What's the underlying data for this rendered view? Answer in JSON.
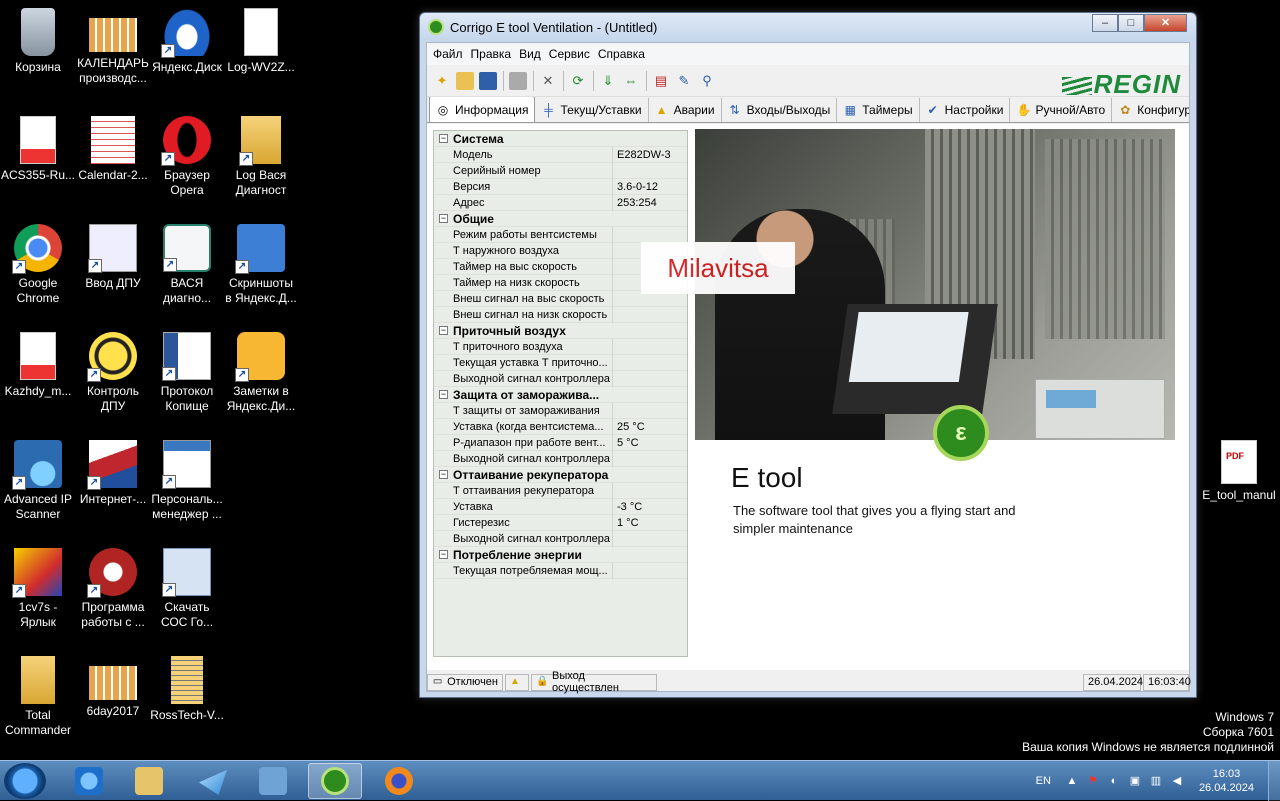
{
  "desktop_icons": [
    {
      "id": "recycle",
      "label": "Корзина",
      "icon": "recycle-bin-icon",
      "col": 0,
      "row": 0
    },
    {
      "id": "cal1",
      "label": "КАЛЕНДАРЬ\nпроизводс...",
      "icon": "spreadsheet-icon",
      "col": 1,
      "row": 0
    },
    {
      "id": "ydisk",
      "label": "Яндекс.Диск",
      "icon": "yandex-disk-icon",
      "col": 2,
      "row": 0
    },
    {
      "id": "log",
      "label": "Log-WV2Z...",
      "icon": "text-file-icon",
      "col": 3,
      "row": 0
    },
    {
      "id": "acs",
      "label": "ACS355-Ru...",
      "icon": "pdf-icon",
      "col": 0,
      "row": 1
    },
    {
      "id": "cal2",
      "label": "Calendar-2...",
      "icon": "calendar-icon",
      "col": 1,
      "row": 1
    },
    {
      "id": "opera",
      "label": "Браузер\nOpera",
      "icon": "opera-icon",
      "col": 2,
      "row": 1
    },
    {
      "id": "logvasya",
      "label": "Log Вася\nДиагност",
      "icon": "folder-icon",
      "col": 3,
      "row": 1
    },
    {
      "id": "chrome",
      "label": "Google\nChrome",
      "icon": "chrome-icon",
      "col": 0,
      "row": 2
    },
    {
      "id": "dpu",
      "label": "Ввод ДПУ",
      "icon": "documents-icon",
      "col": 1,
      "row": 2
    },
    {
      "id": "vasya",
      "label": "ВАСЯ\nдиагно...",
      "icon": "vasya-diag-icon",
      "col": 2,
      "row": 2
    },
    {
      "id": "screens",
      "label": "Скриншоты\nв Яндекс.Д...",
      "icon": "scissors-icon",
      "col": 3,
      "row": 2
    },
    {
      "id": "kazhdy",
      "label": "Kazhdy_m...",
      "icon": "pdf-icon",
      "col": 0,
      "row": 3
    },
    {
      "id": "kdpu",
      "label": "Контроль\nДПУ",
      "icon": "bee-icon",
      "col": 1,
      "row": 3
    },
    {
      "id": "protokol",
      "label": "Протокол\nКопище",
      "icon": "word-doc-icon",
      "col": 2,
      "row": 3
    },
    {
      "id": "notes",
      "label": "Заметки в\nЯндекс.Ди...",
      "icon": "notes-icon",
      "col": 3,
      "row": 3
    },
    {
      "id": "ipscan",
      "label": "Advanced IP\nScanner",
      "icon": "network-scan-icon",
      "col": 0,
      "row": 4
    },
    {
      "id": "inet",
      "label": "Интернет-...",
      "icon": "internet-icon",
      "col": 1,
      "row": 4
    },
    {
      "id": "persmgr",
      "label": "Персональ...\nменеджер ...",
      "icon": "personal-manager-icon",
      "col": 2,
      "row": 4
    },
    {
      "id": "1c",
      "label": "1cv7s -\nЯрлык",
      "icon": "1c-icon",
      "col": 0,
      "row": 5
    },
    {
      "id": "prog",
      "label": "Программа\nработы с ...",
      "icon": "program-icon",
      "col": 1,
      "row": 5
    },
    {
      "id": "soc",
      "label": "Скачать\nСОС Го...",
      "icon": "download-settings-icon",
      "col": 2,
      "row": 5
    },
    {
      "id": "tc",
      "label": "Total\nCommander",
      "icon": "folder-zip-icon",
      "col": 0,
      "row": 6
    },
    {
      "id": "6day",
      "label": "6day2017",
      "icon": "spreadsheet-icon",
      "col": 1,
      "row": 6
    },
    {
      "id": "ross",
      "label": "RossTech-V...",
      "icon": "zip-folder-icon",
      "col": 2,
      "row": 6
    }
  ],
  "right_icon": {
    "label": "E_tool_manul",
    "icon": "pdf-icon"
  },
  "window": {
    "title": "Corrigo E tool Ventilation - (Untitled)",
    "buttons": {
      "minimize": "–",
      "maximize": "□",
      "close": "✕"
    },
    "menu": [
      "Файл",
      "Правка",
      "Вид",
      "Сервис",
      "Справка"
    ],
    "logo": "REGIN",
    "tabs": [
      {
        "label": "Информация",
        "icon": "info-icon",
        "active": true
      },
      {
        "label": "Текущ/Уставки",
        "icon": "setpoint-icon"
      },
      {
        "label": "Аварии",
        "icon": "alarm-bell-icon"
      },
      {
        "label": "Входы/Выходы",
        "icon": "io-arrows-icon"
      },
      {
        "label": "Таймеры",
        "icon": "timer-icon"
      },
      {
        "label": "Настройки",
        "icon": "settings-icon"
      },
      {
        "label": "Ручной/Авто",
        "icon": "hand-icon"
      },
      {
        "label": "Конфигурац",
        "icon": "config-icon"
      }
    ]
  },
  "tree": [
    {
      "type": "sec",
      "name": "Система"
    },
    {
      "name": "Модель",
      "value": "E282DW-3"
    },
    {
      "name": "Серийный номер",
      "value": ""
    },
    {
      "name": "Версия",
      "value": "3.6-0-12"
    },
    {
      "name": "Адрес",
      "value": "253:254"
    },
    {
      "type": "sec",
      "name": "Общие"
    },
    {
      "name": "Режим работы вентсистемы",
      "value": ""
    },
    {
      "name": "Т наружного воздуха",
      "value": ""
    },
    {
      "name": "Таймер на выс скорость",
      "value": ""
    },
    {
      "name": "Таймер на низк скорость",
      "value": ""
    },
    {
      "name": "Внеш сигнал на выс скорость",
      "value": ""
    },
    {
      "name": "Внеш сигнал на низк скорость",
      "value": ""
    },
    {
      "type": "sec",
      "name": "Приточный воздух"
    },
    {
      "name": "Т приточного воздуха",
      "value": ""
    },
    {
      "name": "Текущая уставка Т приточно...",
      "value": ""
    },
    {
      "name": "Выходной сигнал контроллера",
      "value": ""
    },
    {
      "type": "sec",
      "name": "Защита от заморажива..."
    },
    {
      "name": "Т защиты от замораживания",
      "value": ""
    },
    {
      "name": "Уставка (когда вентсистема...",
      "value": "25 °C"
    },
    {
      "name": "Р-диапазон при работе вент...",
      "value": "5 °C"
    },
    {
      "name": "Выходной сигнал контроллера",
      "value": ""
    },
    {
      "type": "sec",
      "name": "Оттаивание рекуператора"
    },
    {
      "name": "Т оттаивания рекуператора",
      "value": ""
    },
    {
      "name": "Уставка",
      "value": "-3 °C"
    },
    {
      "name": "Гистерезис",
      "value": "1 °C"
    },
    {
      "name": "Выходной сигнал контроллера",
      "value": ""
    },
    {
      "type": "sec",
      "name": "Потребление энергии"
    },
    {
      "name": "Текущая потребляемая мощ...",
      "value": ""
    }
  ],
  "splash": {
    "watermark": "Milavitsa",
    "badge": "ε",
    "title": "E tool",
    "tagline": "The software tool that gives you a flying start and simpler maintenance"
  },
  "status": {
    "connection": "Отключен",
    "login": "Выход осуществлен",
    "date": "26.04.2024",
    "time": "16:03:40"
  },
  "windows_notice": [
    "Windows 7",
    "Сборка 7601",
    "Ваша копия Windows не является подлинной"
  ],
  "taskbar": {
    "apps": [
      "ie-icon",
      "explorer-icon",
      "telegram-icon",
      "network-tool-icon",
      "etool-icon",
      "firefox-icon"
    ],
    "lang": "EN",
    "clock_time": "16:03",
    "clock_date": "26.04.2024"
  }
}
